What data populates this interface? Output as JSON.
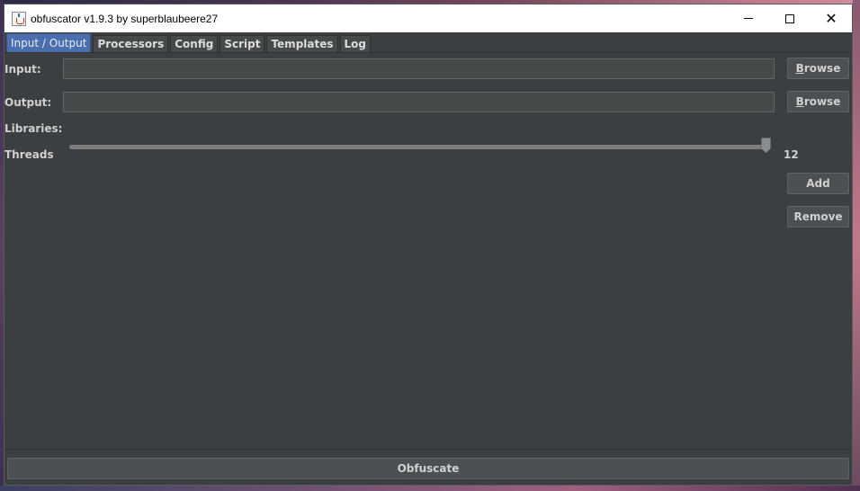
{
  "window": {
    "title": "obfuscator v1.9.3 by superblaubeere27"
  },
  "tabs": [
    {
      "label": "Input / Output",
      "active": true
    },
    {
      "label": "Processors",
      "active": false
    },
    {
      "label": "Config",
      "active": false
    },
    {
      "label": "Script",
      "active": false
    },
    {
      "label": "Templates",
      "active": false
    },
    {
      "label": "Log",
      "active": false
    }
  ],
  "io": {
    "input_label": "Input:",
    "input_value": "",
    "output_label": "Output:",
    "output_value": "",
    "browse_first": "B",
    "browse_rest": "rowse",
    "libraries_label": "Libraries:",
    "threads_label": "Threads",
    "threads_value": "12",
    "threads_fraction": 1.0,
    "add_label": "Add",
    "remove_label": "Remove"
  },
  "actions": {
    "obfuscate_label": "Obfuscate"
  },
  "colors": {
    "background": "#3c3f41",
    "active_tab": "#4b6eaf"
  }
}
